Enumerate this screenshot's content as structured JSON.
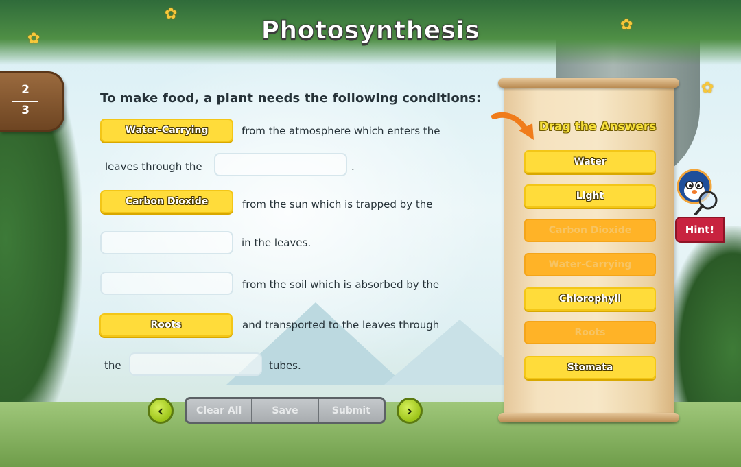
{
  "title": "Photosynthesis",
  "page": {
    "current": "2",
    "total": "3"
  },
  "question": {
    "heading": "To make food, a plant needs the following conditions:",
    "line1_text": "from the atmosphere which enters the",
    "line2_text": "leaves through the",
    "line2_period": ".",
    "line3_text": "from the sun which is trapped by the",
    "line4_text": "in the leaves.",
    "line5_text": "from the soil which is absorbed by the",
    "line6_text": "and transported to the leaves through",
    "line7_pre": "the",
    "line7_post": "tubes.",
    "placed": {
      "slot1": "Water-Carrying",
      "slot3": "Carbon Dioxide",
      "slot6": "Roots"
    }
  },
  "bank": {
    "title": "Drag the Answers",
    "items": [
      {
        "label": "Water",
        "state": "available"
      },
      {
        "label": "Light",
        "state": "available"
      },
      {
        "label": "Carbon Dioxide",
        "state": "used"
      },
      {
        "label": "Water-Carrying",
        "state": "used"
      },
      {
        "label": "Chlorophyll",
        "state": "available"
      },
      {
        "label": "Roots",
        "state": "used"
      },
      {
        "label": "Stomata",
        "state": "available"
      }
    ]
  },
  "hint_label": "Hint!",
  "controls": {
    "clear_all": "Clear All",
    "save": "Save",
    "submit": "Submit",
    "prev_icon": "chevron-left-icon",
    "next_icon": "chevron-right-icon"
  },
  "colors": {
    "answer_yellow": "#ffdc3a",
    "used_orange": "#ffb327",
    "hint_red": "#c8233f",
    "nav_green": "#9dc41a"
  }
}
